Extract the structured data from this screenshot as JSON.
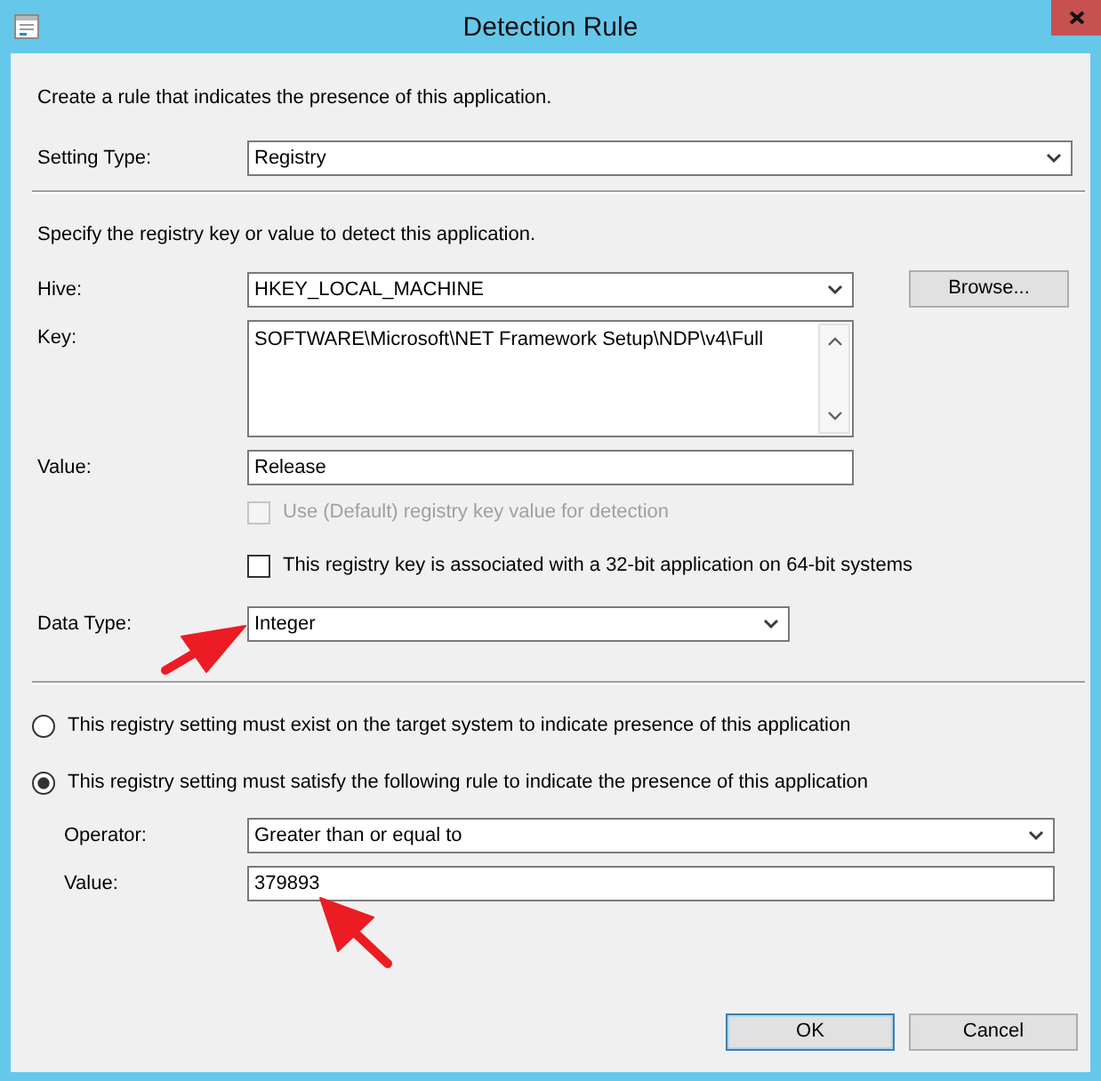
{
  "window": {
    "title": "Detection Rule"
  },
  "intro": "Create a rule that indicates the presence of this application.",
  "setting_type": {
    "label": "Setting Type:",
    "value": "Registry"
  },
  "registry": {
    "instruction": "Specify the registry key or value to detect this application.",
    "hive": {
      "label": "Hive:",
      "value": "HKEY_LOCAL_MACHINE"
    },
    "browse_button": "Browse...",
    "key": {
      "label": "Key:",
      "value": "SOFTWARE\\Microsoft\\NET Framework Setup\\NDP\\v4\\Full"
    },
    "value": {
      "label": "Value:",
      "value": "Release"
    },
    "checkboxes": [
      {
        "label": "Use (Default) registry key value for detection",
        "checked": false,
        "disabled": true
      },
      {
        "label": "This registry key is associated with a 32-bit application on 64-bit systems",
        "checked": false,
        "disabled": false
      }
    ],
    "data_type": {
      "label": "Data Type:",
      "value": "Integer"
    }
  },
  "rule_options": [
    {
      "label": "This registry setting must exist on the target system to indicate presence of this application",
      "selected": false
    },
    {
      "label": "This registry setting must satisfy the following rule to indicate the presence of this application",
      "selected": true
    }
  ],
  "rule": {
    "operator": {
      "label": "Operator:",
      "value": "Greater than or equal to"
    },
    "value": {
      "label": "Value:",
      "value": "379893"
    }
  },
  "buttons": [
    {
      "label": "OK",
      "default": true
    },
    {
      "label": "Cancel",
      "default": false
    }
  ]
}
